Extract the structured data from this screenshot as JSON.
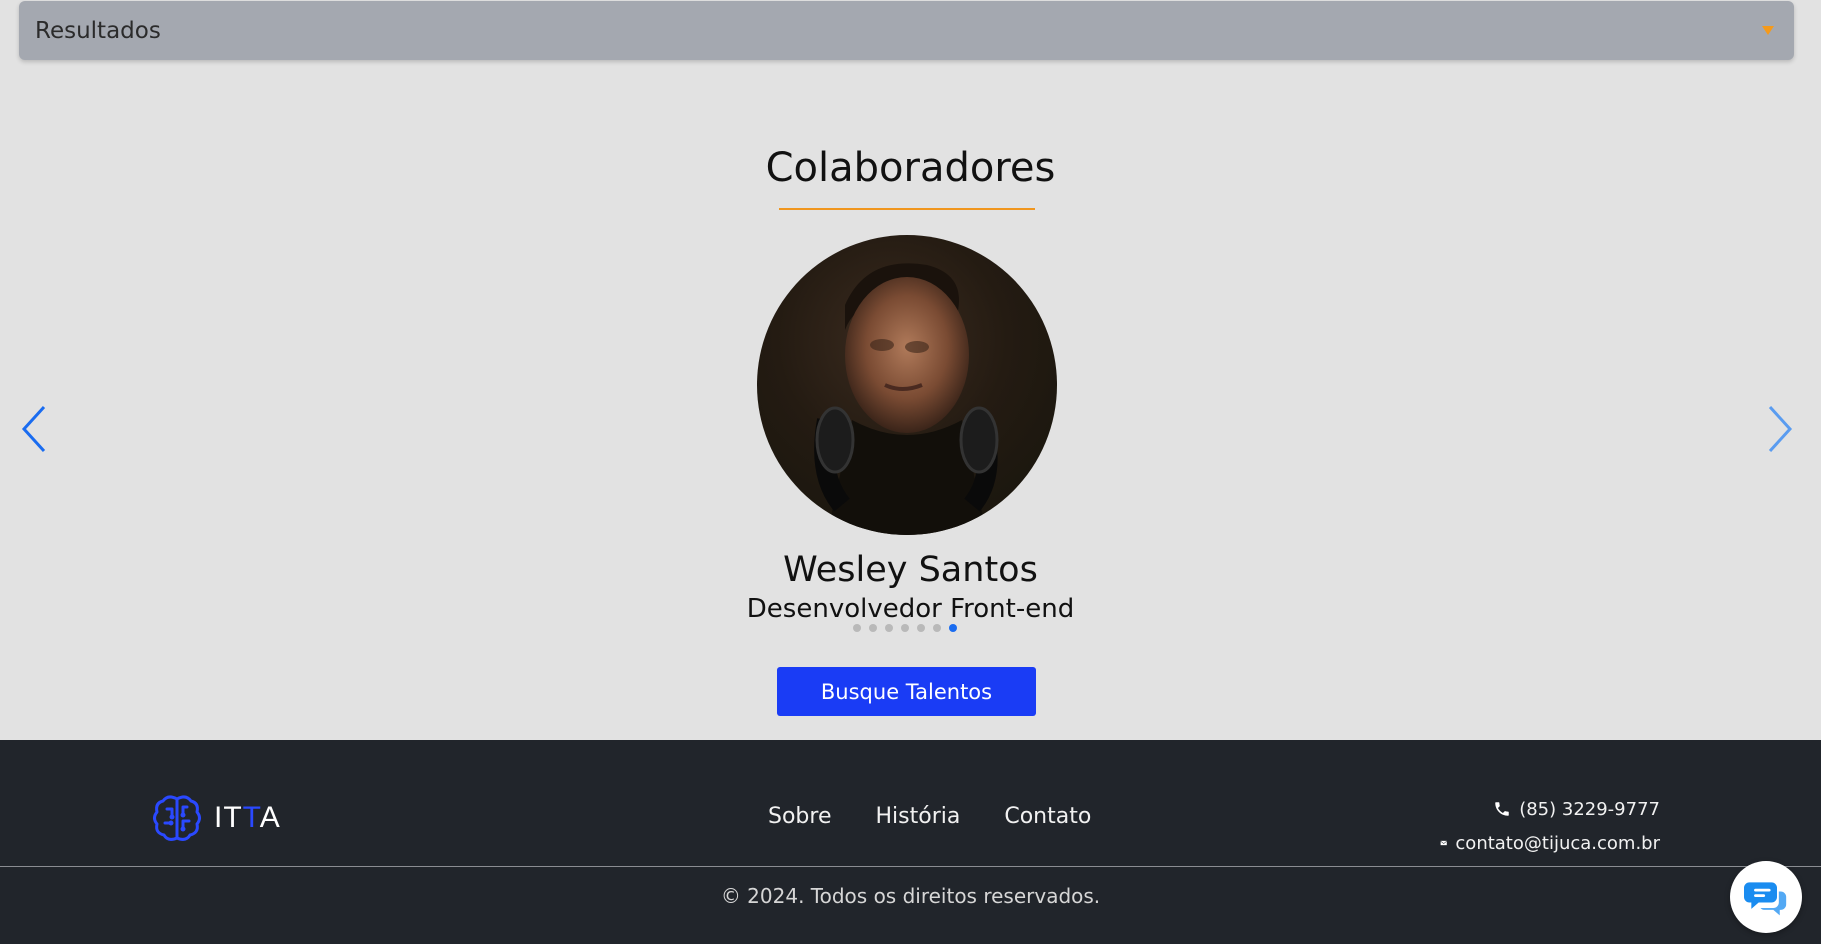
{
  "accordion": {
    "title": "Resultados",
    "caret_icon": "caret-down-icon",
    "caret_color": "#f59a1a"
  },
  "section": {
    "title": "Colaboradores",
    "underline_color": "#f0961e"
  },
  "carousel": {
    "prev_icon": "chevron-left-icon",
    "next_icon": "chevron-right-icon",
    "arrow_color": "#1a6cf0",
    "current": {
      "name": "Wesley Santos",
      "role": "Desenvolvedor Front-end"
    },
    "slide_count": 7,
    "active_index": 6
  },
  "cta": {
    "label": "Busque Talentos",
    "color": "#1a3cf5"
  },
  "footer": {
    "logo": {
      "icon": "brain-circuit-icon",
      "text_part1": "IT",
      "text_accent": "T",
      "text_part2": "A",
      "accent_color": "#2a49ff"
    },
    "nav": [
      "Sobre",
      "História",
      "Contato"
    ],
    "contact": {
      "phone": "(85) 3229-9777",
      "phone_icon": "phone-icon",
      "email": "contato@tijuca.com.br",
      "email_icon": "envelope-icon"
    },
    "copyright": "© 2024. Todos os direitos reservados.",
    "background": "#21252b"
  },
  "chat": {
    "icon": "chat-bubbles-icon",
    "color": "#1a8cf0"
  }
}
